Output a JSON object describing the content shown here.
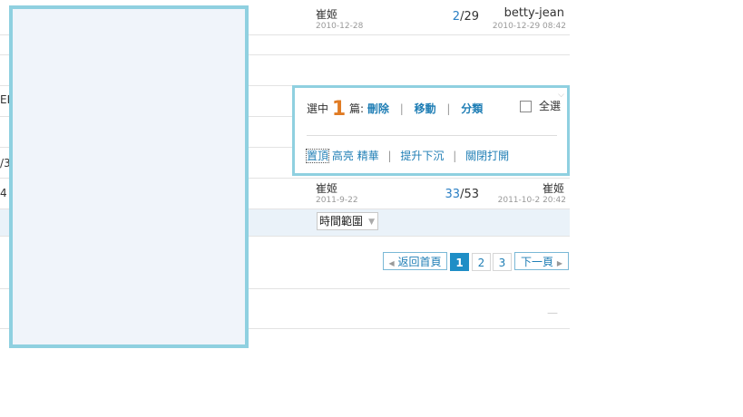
{
  "rows": [
    {
      "author": "崔姬",
      "date": "2010-12-28",
      "replies": "2",
      "views": "29",
      "last_user": "betty-jean",
      "last_time": "2010-12-29 08:42"
    },
    {
      "author": "崔姬",
      "date": "2011-9-22",
      "replies": "33",
      "views": "53",
      "last_user": "崔姬",
      "last_time": "2011-10-2 20:42"
    }
  ],
  "left_fragments": [
    "EP",
    "/3",
    "4"
  ],
  "popup": {
    "selected_prefix": "選中",
    "selected_count": "1",
    "selected_suffix": "篇:",
    "delete": "刪除",
    "move": "移動",
    "categorize": "分類",
    "sep": "|",
    "select_all": "全選",
    "pin": "置頂",
    "highlight": "高亮",
    "digest": "精華",
    "raise_lower": "提升下沉",
    "close_open": "關閉打開"
  },
  "filter": {
    "time_range": "時間範圍"
  },
  "pagination": {
    "back": "返回首頁",
    "pages": [
      "1",
      "2",
      "3"
    ],
    "current": "1",
    "next": "下一頁"
  },
  "footer_mark": "—",
  "colors": {
    "accent": "#1f8ec6",
    "count": "#e07b24",
    "panel_border": "#8fd0e0",
    "panel_bg": "#f0f4fa"
  }
}
